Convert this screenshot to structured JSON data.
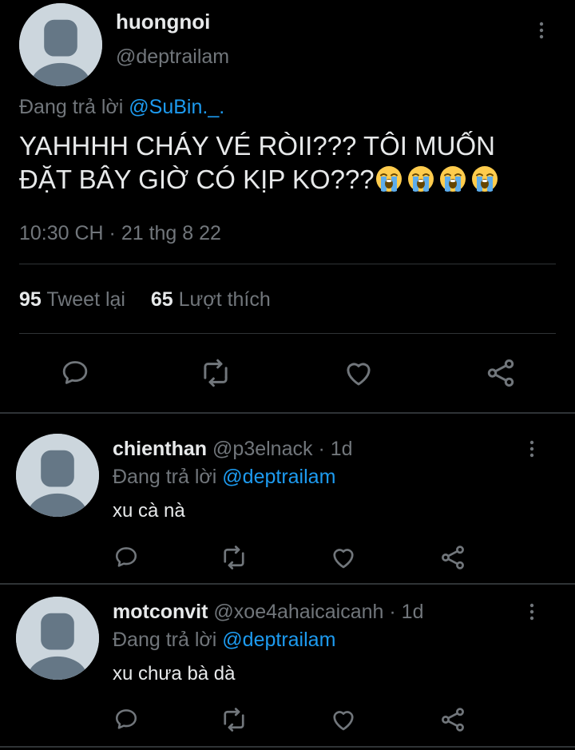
{
  "main_tweet": {
    "display_name": "huongnoi",
    "handle": "@deptrailam",
    "replying_prefix": "Đang trả lời",
    "replying_to": "@SuBin._.",
    "text_line1": "YAHHHH CHÁY VÉ RÒII??? TÔI MUỐN",
    "text_line2": "ĐẶT BÂY GIỜ CÓ KỊP KO???",
    "emoji_count": 4,
    "emoji_name": "loudly-crying-face",
    "timestamp": "10:30 CH · 21 thg 8 22",
    "retweets_count": "95",
    "retweets_label": "Tweet lại",
    "likes_count": "65",
    "likes_label": "Lượt thích"
  },
  "replies": [
    {
      "display_name": "chienthan",
      "handle": "@p3elnack",
      "time": "· 1d",
      "replying_prefix": "Đang trả lời",
      "replying_to": "@deptrailam",
      "text": "xu cà nà"
    },
    {
      "display_name": "motconvit",
      "handle": "@xoe4ahaicaicanh",
      "time": "· 1d",
      "replying_prefix": "Đang trả lời",
      "replying_to": "@deptrailam",
      "text": "xu chưa bà dà"
    }
  ],
  "colors": {
    "background": "#000000",
    "text_primary": "#e7e9ea",
    "text_secondary": "#71767b",
    "accent": "#1d9bf0",
    "divider": "#2f3336",
    "avatar_bg": "#ccd6dd",
    "avatar_fg": "#657786"
  }
}
